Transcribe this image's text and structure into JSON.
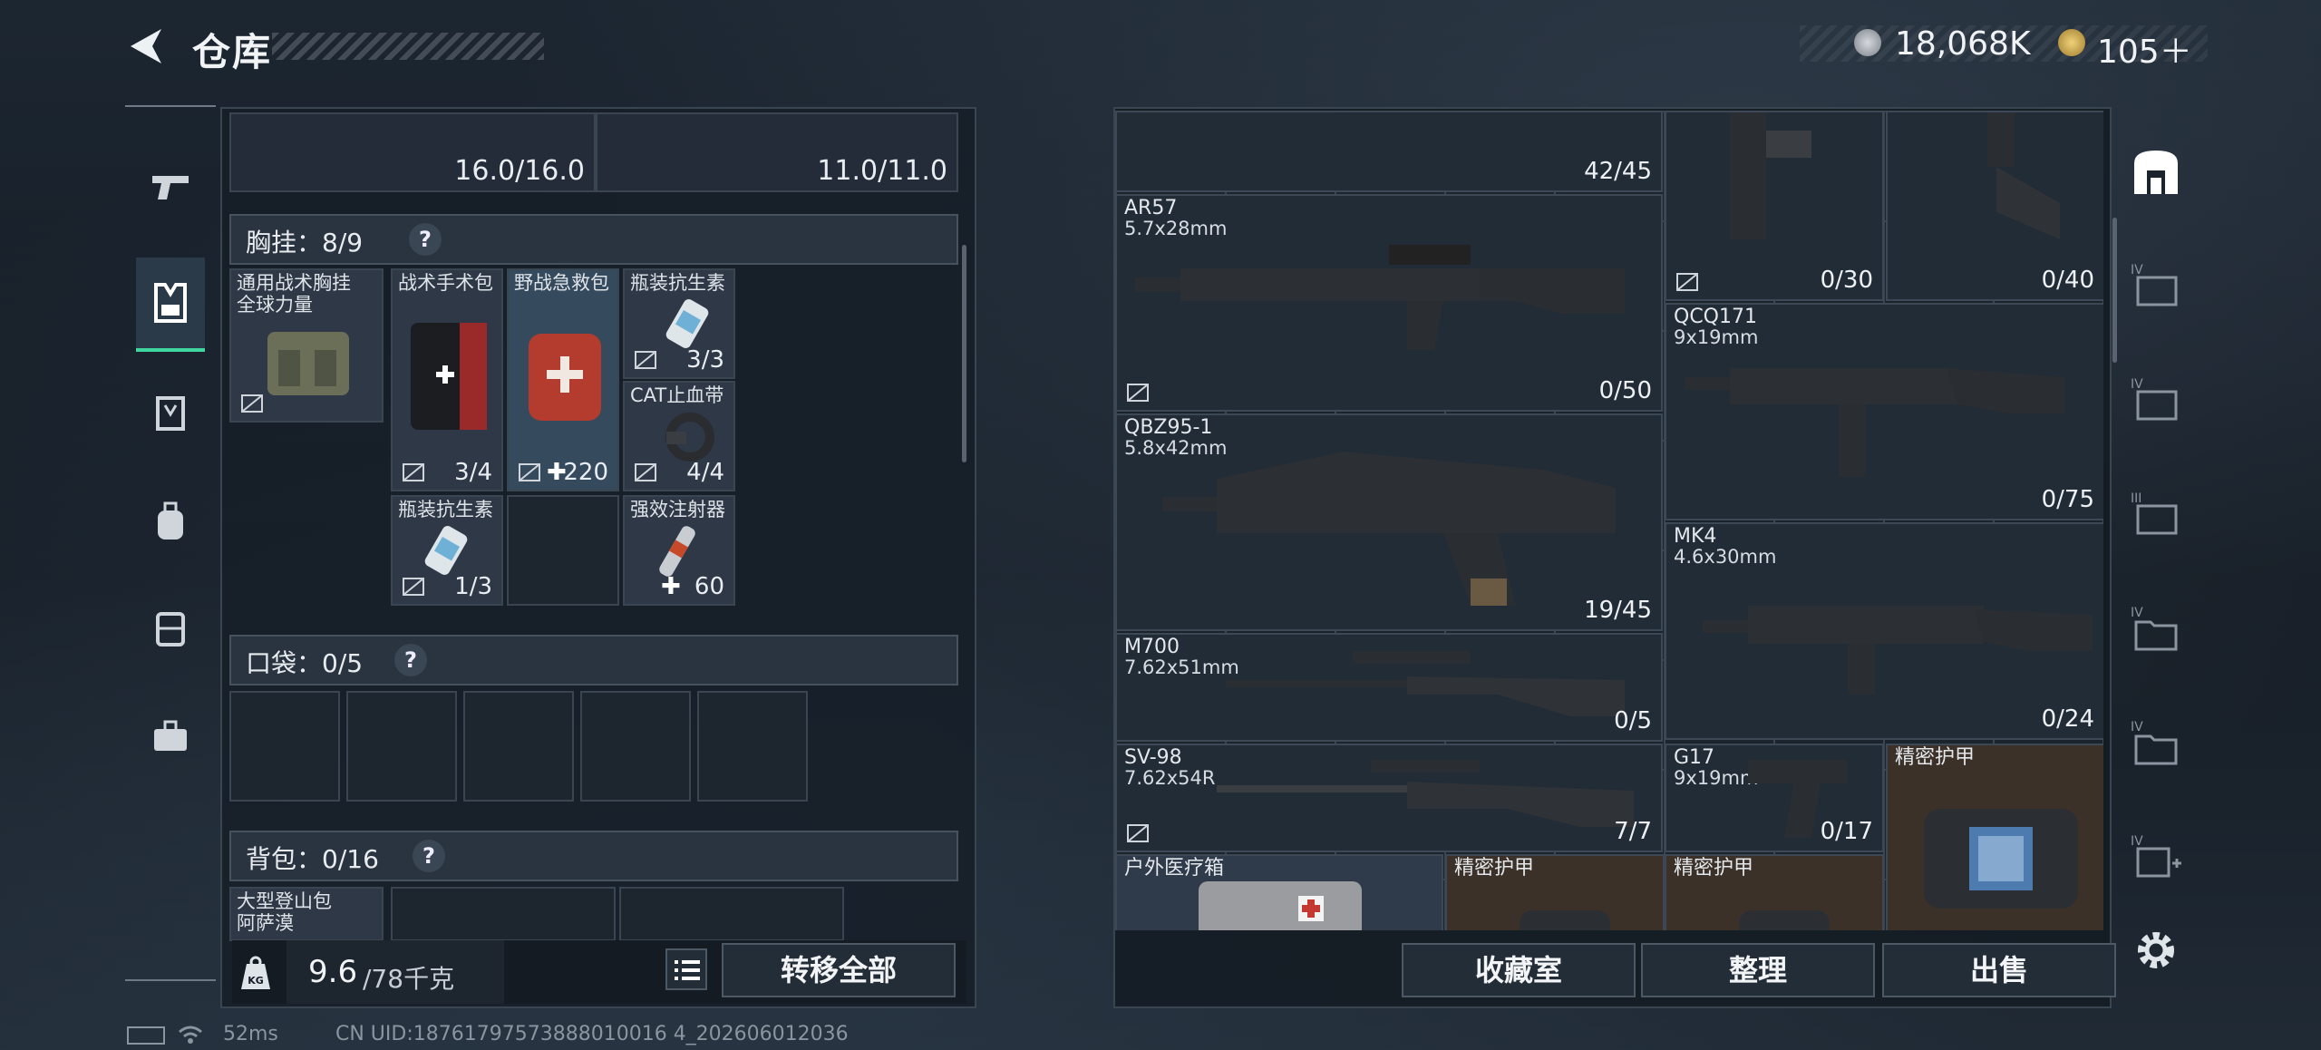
{
  "header": {
    "title": "仓库",
    "currency": [
      {
        "icon": "silver-coin-icon",
        "value": "18,068K"
      },
      {
        "icon": "gold-coin-icon",
        "value": "105＋"
      }
    ]
  },
  "categories": [
    {
      "icon": "pistol-icon",
      "active": false
    },
    {
      "icon": "chest-rig-icon",
      "active": true
    },
    {
      "icon": "armor-vest-icon",
      "active": false
    },
    {
      "icon": "backpack-icon",
      "active": false
    },
    {
      "icon": "container-icon",
      "active": false
    },
    {
      "icon": "toolbox-icon",
      "active": false
    }
  ],
  "equipment": {
    "top_slots": [
      {
        "value": "16.0/16.0"
      },
      {
        "value": "11.0/11.0"
      }
    ],
    "chest": {
      "label": "胸挂：",
      "count": "8/9",
      "help": "?",
      "rig_name": "通用战术胸挂",
      "rig_subname": "全球力量",
      "items": [
        {
          "name": "战术手术包",
          "count": "3/4"
        },
        {
          "name": "野战急救包",
          "count": "220"
        },
        {
          "name": "瓶装抗生素",
          "count": "3/3"
        },
        {
          "name": "CAT止血带",
          "count": "4/4"
        },
        {
          "name": "瓶装抗生素",
          "count": "1/3"
        },
        {
          "name": "强效注射器",
          "count": "60"
        }
      ]
    },
    "pocket": {
      "label": "口袋：",
      "count": "0/5",
      "help": "?"
    },
    "backpack": {
      "label": "背包：",
      "count": "0/16",
      "help": "?",
      "bag_name": "大型登山包",
      "bag_subname": "阿萨漠"
    }
  },
  "footer": {
    "weight": "9.6",
    "weight_unit": "/78千克",
    "transfer_all": "转移全部",
    "collection": "收藏室",
    "sort": "整理",
    "sell": "出售",
    "ping": "52ms",
    "uid": "CN UID:18761797573888010016 4_202606012036"
  },
  "stash": {
    "items": [
      {
        "name": "",
        "caliber": "",
        "count": "42/45"
      },
      {
        "name": "",
        "caliber": "",
        "count": "0/30"
      },
      {
        "name": "",
        "caliber": "",
        "count": "0/40"
      },
      {
        "name": "AR57",
        "caliber": "5.7x28mm",
        "count": "0/50"
      },
      {
        "name": "QCQ171",
        "caliber": "9x19mm",
        "count": "0/75"
      },
      {
        "name": "QBZ95-1",
        "caliber": "5.8x42mm",
        "count": "19/45"
      },
      {
        "name": "MK4",
        "caliber": "4.6x30mm",
        "count": "0/24"
      },
      {
        "name": "M700",
        "caliber": "7.62x51mm",
        "count": "0/5"
      },
      {
        "name": "SV-98",
        "caliber": "7.62x54R",
        "count": "7/7"
      },
      {
        "name": "G17",
        "caliber": "9x19mm",
        "count": "0/17"
      },
      {
        "name": "精密护甲",
        "caliber": "",
        "count": ""
      },
      {
        "name": "户外医疗箱",
        "caliber": "",
        "count": ""
      },
      {
        "name": "精密护甲",
        "caliber": "",
        "count": ""
      },
      {
        "name": "精密护甲",
        "caliber": "",
        "count": ""
      }
    ]
  },
  "side_tabs": [
    {
      "icon": "stash-home-icon"
    },
    {
      "icon": "storage-iv-icon"
    },
    {
      "icon": "storage-iv-icon"
    },
    {
      "icon": "storage-iii-icon"
    },
    {
      "icon": "folder-iv-icon"
    },
    {
      "icon": "folder-iv-icon"
    },
    {
      "icon": "add-storage-iv-icon"
    },
    {
      "icon": "settings-gear-icon"
    }
  ]
}
